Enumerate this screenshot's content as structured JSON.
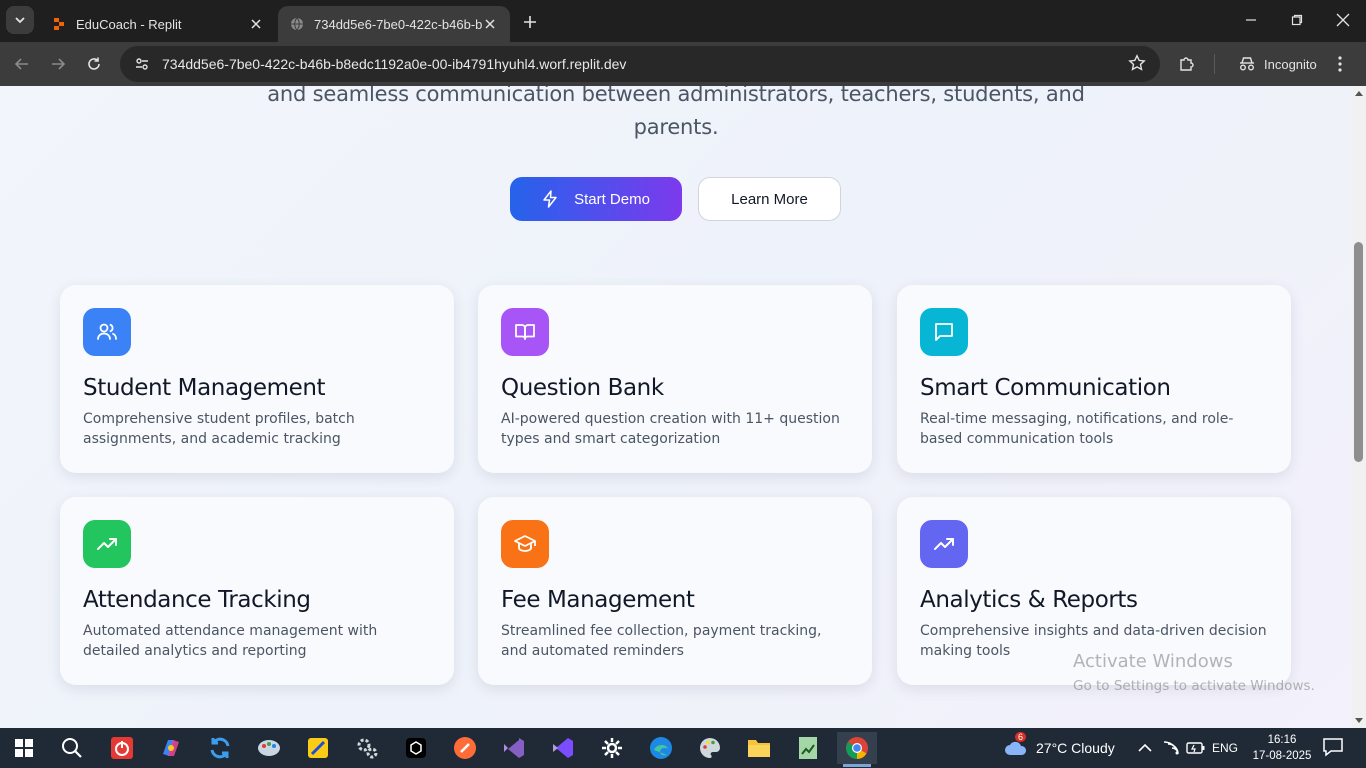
{
  "browser": {
    "tabs": [
      {
        "title": "EduCoach - Replit",
        "active": false,
        "icon": "replit-icon"
      },
      {
        "title": "734dd5e6-7be0-422c-b46b-b8edc1192a0e-00-ib4791hyuhl4.worf.replit.dev",
        "active": true,
        "icon": "globe-icon"
      }
    ],
    "url": "734dd5e6-7be0-422c-b46b-b8edc1192a0e-00-ib4791hyuhl4.worf.replit.dev",
    "incognito_label": "Incognito"
  },
  "hero": {
    "line1": "and seamless communication between administrators, teachers, students, and",
    "line2": "parents.",
    "primary_button": "Start Demo",
    "secondary_button": "Learn More"
  },
  "features": [
    {
      "title": "Student Management",
      "desc": "Comprehensive student profiles, batch assignments, and academic tracking",
      "icon": "users-icon",
      "color": "#3b82f6"
    },
    {
      "title": "Question Bank",
      "desc": "AI-powered question creation with 11+ question types and smart categorization",
      "icon": "book-open-icon",
      "color": "#a855f7"
    },
    {
      "title": "Smart Communication",
      "desc": "Real-time messaging, notifications, and role-based communication tools",
      "icon": "message-square-icon",
      "color": "#06b6d4"
    },
    {
      "title": "Attendance Tracking",
      "desc": "Automated attendance management with detailed analytics and reporting",
      "icon": "trending-up-icon",
      "color": "#22c55e"
    },
    {
      "title": "Fee Management",
      "desc": "Streamlined fee collection, payment tracking, and automated reminders",
      "icon": "graduation-cap-icon",
      "color": "#f97316"
    },
    {
      "title": "Analytics & Reports",
      "desc": "Comprehensive insights and data-driven decision making tools",
      "icon": "trending-up-icon",
      "color": "#6366f1"
    }
  ],
  "watermark": {
    "line1": "Activate Windows",
    "line2": "Go to Settings to activate Windows."
  },
  "taskbar": {
    "weather": "27°C  Cloudy",
    "weather_badge": "6",
    "lang": "ENG",
    "time": "16:16",
    "date": "17-08-2025"
  }
}
